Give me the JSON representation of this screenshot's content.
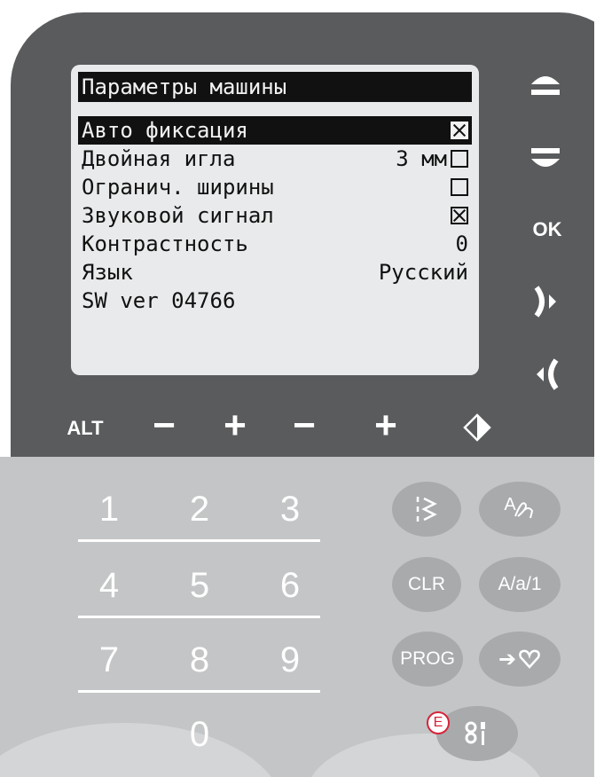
{
  "colors": {
    "panel_dark": "#595b5c",
    "panel_light": "#c4c5c6",
    "lcd_bg": "#e9eaeb",
    "button_bg": "#a9aaac",
    "badge_red": "#d6253a"
  },
  "lcd": {
    "title": "Параметры машины",
    "rows": [
      {
        "label": "Авто фиксация",
        "value": "",
        "checkbox": true,
        "checked": true,
        "selected": true
      },
      {
        "label": "Двойная игла",
        "value": "3 мм",
        "checkbox": true,
        "checked": false,
        "selected": false
      },
      {
        "label": "Огранич. ширины",
        "value": "",
        "checkbox": true,
        "checked": false,
        "selected": false
      },
      {
        "label": "Звуковой сигнал",
        "value": "",
        "checkbox": true,
        "checked": true,
        "selected": false
      },
      {
        "label": "Контрастность",
        "value": "0",
        "checkbox": false,
        "selected": false
      },
      {
        "label": "Язык",
        "value": "Русский",
        "checkbox": false,
        "selected": false
      },
      {
        "label": "SW ver 04766",
        "value": "",
        "checkbox": false,
        "selected": false
      }
    ]
  },
  "side_buttons": {
    "up_icon": "arrow-up-icon",
    "down_icon": "arrow-down-icon",
    "ok_label": "OK",
    "right_icon": "right-bracket-icon",
    "left_icon": "left-bracket-icon"
  },
  "alt_row": {
    "alt": "ALT",
    "minus": "−",
    "plus": "+",
    "diamond_icon": "mirror-diamond-icon"
  },
  "keypad": {
    "keys": [
      "1",
      "2",
      "3",
      "4",
      "5",
      "6",
      "7",
      "8",
      "9",
      "0"
    ]
  },
  "function_buttons": {
    "stitch_icon": "stitch-icon",
    "font_label": "A",
    "clr": "CLR",
    "case": "A/a/1",
    "prog": "PROG",
    "save_arrow": "➔",
    "heart_icon": "heart-icon",
    "settings_icon": "tools-icon",
    "badge": "E"
  }
}
